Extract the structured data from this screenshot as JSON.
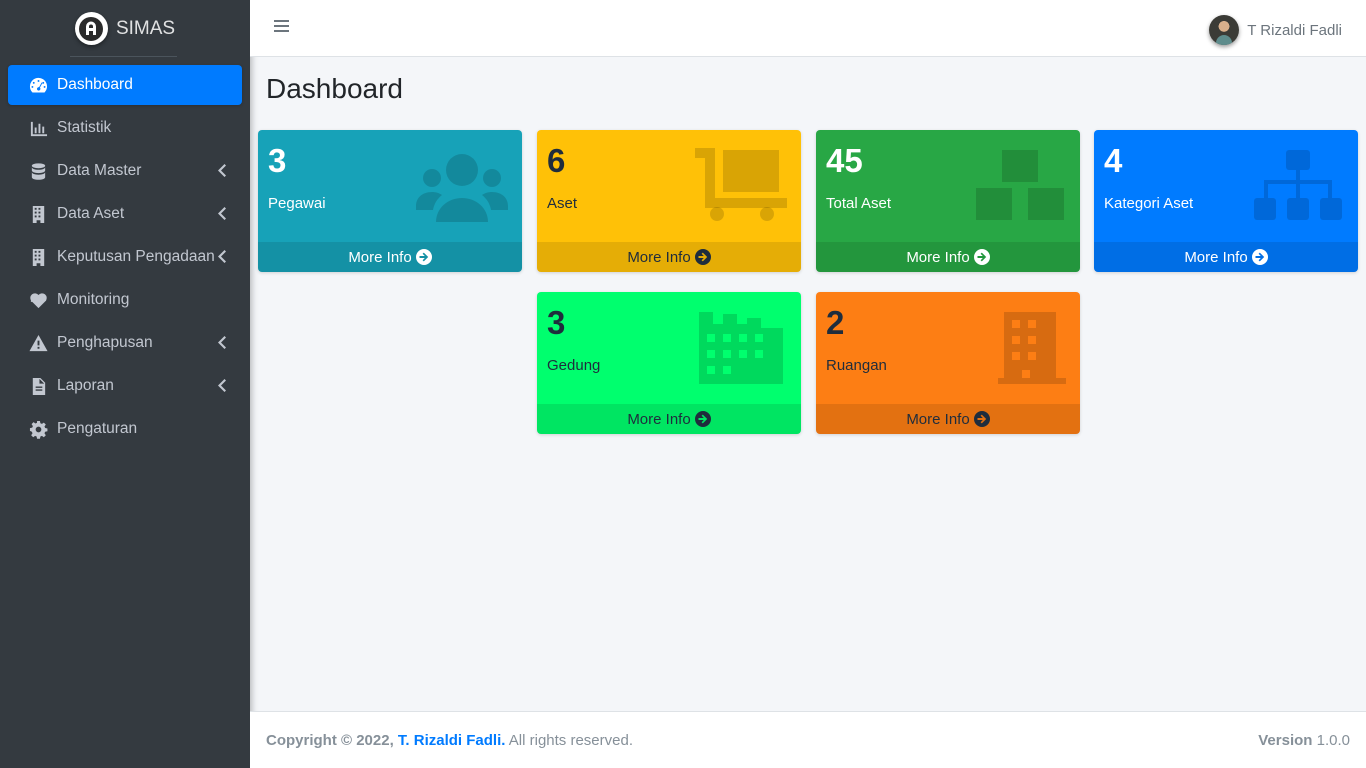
{
  "brand": {
    "name": "SIMAS"
  },
  "sidebar": {
    "items": [
      {
        "label": "Dashboard",
        "icon": "tachometer-icon",
        "active": true
      },
      {
        "label": "Statistik",
        "icon": "chart-bar-icon"
      },
      {
        "label": "Data Master",
        "icon": "database-icon",
        "has_submenu": true
      },
      {
        "label": "Data Aset",
        "icon": "building-icon",
        "has_submenu": true
      },
      {
        "label": "Keputusan Pengadaan",
        "icon": "building-icon",
        "has_submenu": true
      },
      {
        "label": "Monitoring",
        "icon": "heartbeat-icon"
      },
      {
        "label": "Penghapusan",
        "icon": "warning-icon",
        "has_submenu": true
      },
      {
        "label": "Laporan",
        "icon": "file-icon",
        "has_submenu": true
      },
      {
        "label": "Pengaturan",
        "icon": "gear-icon"
      }
    ]
  },
  "header": {
    "user_name": "T Rizaldi Fadli"
  },
  "main": {
    "title": "Dashboard",
    "cards": [
      {
        "value": "3",
        "label": "Pegawai",
        "footer": "More Info",
        "color": "#17a2b8",
        "icon": "users-icon"
      },
      {
        "value": "6",
        "label": "Aset",
        "footer": "More Info",
        "color": "#ffc107",
        "icon": "dolly-icon"
      },
      {
        "value": "45",
        "label": "Total Aset",
        "footer": "More Info",
        "color": "#28a745",
        "icon": "boxes-icon"
      },
      {
        "value": "4",
        "label": "Kategori Aset",
        "footer": "More Info",
        "color": "#007bff",
        "icon": "sitemap-icon"
      },
      {
        "value": "3",
        "label": "Gedung",
        "footer": "More Info",
        "color": "#00ff6e",
        "icon": "industry-icon"
      },
      {
        "value": "2",
        "label": "Ruangan",
        "footer": "More Info",
        "color": "#fd7e14",
        "icon": "building-icon"
      }
    ]
  },
  "footer": {
    "copyright_prefix": "Copyright © 2022,",
    "author": "T. Rizaldi Fadli.",
    "rights": "All rights reserved.",
    "version_label": "Version",
    "version_value": "1.0.0"
  }
}
